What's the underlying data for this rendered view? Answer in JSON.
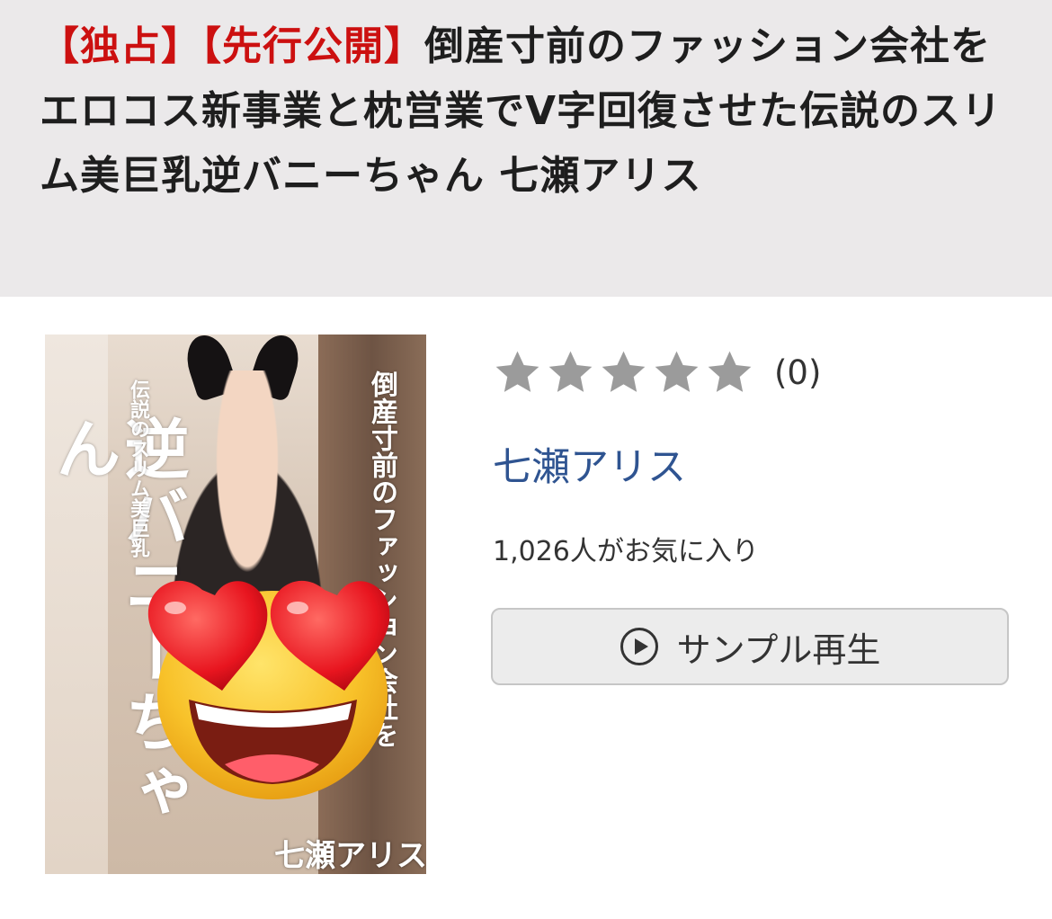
{
  "title": {
    "tag_exclusive": "【独占】",
    "tag_preview": "【先行公開】",
    "text": "倒産寸前のファッション会社をエロコス新事業と枕営業でV字回復させた伝説のスリム美巨乳逆バニーちゃん 七瀬アリス"
  },
  "cover": {
    "main_title": "逆バニーちゃん",
    "sub_title": "伝説のスリム美巨乳",
    "right_title": "倒産寸前のファッション会社を",
    "actress": "七瀬アリス",
    "overlay_emoji": "heart-eyes-emoji"
  },
  "rating": {
    "stars_filled": 0,
    "stars_total": 5,
    "count": "(0)",
    "star_color": "#9b9b9b"
  },
  "actress_name": "七瀬アリス",
  "favorites": "1,026人がお気に入り",
  "sample_button": {
    "label": "サンプル再生",
    "icon": "play-circle-icon"
  },
  "colors": {
    "title_band_bg": "#ebe9ea",
    "tag_red": "#cc1010",
    "link_blue": "#2f5491",
    "button_bg": "#ececec"
  }
}
